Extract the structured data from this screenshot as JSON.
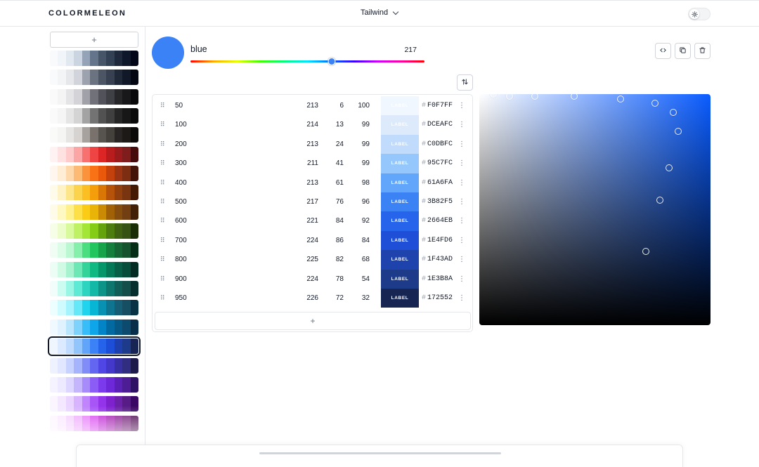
{
  "app": {
    "logo": "COLORMELEON",
    "palette_set": "Tailwind"
  },
  "sidebar": {
    "add_label": "+",
    "palettes": [
      [
        "#f8fafc",
        "#f1f5f9",
        "#e2e8f0",
        "#cbd5e1",
        "#94a3b8",
        "#64748b",
        "#475569",
        "#334155",
        "#1e293b",
        "#0f172a",
        "#020617"
      ],
      [
        "#f9fafb",
        "#f3f4f6",
        "#e5e7eb",
        "#d1d5db",
        "#9ca3af",
        "#6b7280",
        "#4b5563",
        "#374151",
        "#1f2937",
        "#111827",
        "#030712"
      ],
      [
        "#fafafa",
        "#f4f4f5",
        "#e4e4e7",
        "#d4d4d8",
        "#a1a1aa",
        "#71717a",
        "#52525b",
        "#3f3f46",
        "#27272a",
        "#18181b",
        "#09090b"
      ],
      [
        "#fafafa",
        "#f5f5f5",
        "#e5e5e5",
        "#d4d4d4",
        "#a3a3a3",
        "#737373",
        "#525252",
        "#404040",
        "#262626",
        "#171717",
        "#0a0a0a"
      ],
      [
        "#fafaf9",
        "#f5f5f4",
        "#e7e5e4",
        "#d6d3d1",
        "#a8a29e",
        "#78716c",
        "#57534e",
        "#44403c",
        "#292524",
        "#1c1917",
        "#0c0a09"
      ],
      [
        "#fef2f2",
        "#fee2e2",
        "#fecaca",
        "#fca5a5",
        "#f87171",
        "#ef4444",
        "#dc2626",
        "#b91c1c",
        "#991b1b",
        "#7f1d1d",
        "#450a0a"
      ],
      [
        "#fff7ed",
        "#ffedd5",
        "#fed7aa",
        "#fdba74",
        "#fb923c",
        "#f97316",
        "#ea580c",
        "#c2410c",
        "#9a3412",
        "#7c2d12",
        "#431407"
      ],
      [
        "#fffbeb",
        "#fef3c7",
        "#fde68a",
        "#fcd34d",
        "#fbbf24",
        "#f59e0b",
        "#d97706",
        "#b45309",
        "#92400e",
        "#78350f",
        "#451a03"
      ],
      [
        "#fefce8",
        "#fef9c3",
        "#fef08a",
        "#fde047",
        "#facc15",
        "#eab308",
        "#ca8a04",
        "#a16207",
        "#854d0e",
        "#713f12",
        "#422006"
      ],
      [
        "#f7fee7",
        "#ecfccb",
        "#d9f99d",
        "#bef264",
        "#a3e635",
        "#84cc16",
        "#65a30d",
        "#4d7c0f",
        "#3f6212",
        "#365314",
        "#1a2e05"
      ],
      [
        "#f0fdf4",
        "#dcfce7",
        "#bbf7d0",
        "#86efac",
        "#4ade80",
        "#22c55e",
        "#16a34a",
        "#15803d",
        "#166534",
        "#14532d",
        "#052e16"
      ],
      [
        "#ecfdf5",
        "#d1fae5",
        "#a7f3d0",
        "#6ee7b7",
        "#34d399",
        "#10b981",
        "#059669",
        "#047857",
        "#065f46",
        "#064e3b",
        "#022c22"
      ],
      [
        "#f0fdfa",
        "#ccfbf1",
        "#99f6e4",
        "#5eead4",
        "#2dd4bf",
        "#14b8a6",
        "#0d9488",
        "#0f766e",
        "#115e59",
        "#134e4a",
        "#042f2e"
      ],
      [
        "#ecfeff",
        "#cffafe",
        "#a5f3fc",
        "#67e8f9",
        "#22d3ee",
        "#06b6d4",
        "#0891b2",
        "#0e7490",
        "#155e75",
        "#164e63",
        "#083344"
      ],
      [
        "#f0f9ff",
        "#e0f2fe",
        "#bae6fd",
        "#7dd3fc",
        "#38bdf8",
        "#0ea5e9",
        "#0284c7",
        "#0369a1",
        "#075985",
        "#0c4a6e",
        "#082f49"
      ],
      [
        "#eff6ff",
        "#dbeafe",
        "#bfdbfe",
        "#93c5fd",
        "#60a5fa",
        "#3b82f6",
        "#2563eb",
        "#1d4ed8",
        "#1e40af",
        "#1e3a8a",
        "#172554"
      ],
      [
        "#eef2ff",
        "#e0e7ff",
        "#c7d2fe",
        "#a5b4fc",
        "#818cf8",
        "#6366f1",
        "#4f46e5",
        "#4338ca",
        "#3730a3",
        "#312e81",
        "#1e1b4b"
      ],
      [
        "#f5f3ff",
        "#ede9fe",
        "#ddd6fe",
        "#c4b5fd",
        "#a78bfa",
        "#8b5cf6",
        "#7c3aed",
        "#6d28d9",
        "#5b21b6",
        "#4c1d95",
        "#2e1065"
      ],
      [
        "#faf5ff",
        "#f3e8ff",
        "#e9d5ff",
        "#d8b4fe",
        "#c084fc",
        "#a855f7",
        "#9333ea",
        "#7e22ce",
        "#6b21a8",
        "#581c87",
        "#3b0764"
      ],
      [
        "#fdf4ff",
        "#fae8ff",
        "#f5d0fe",
        "#f0abfc",
        "#e879f9",
        "#d946ef",
        "#c026d3",
        "#a21caf",
        "#86198f",
        "#701a75",
        "#4a044e"
      ]
    ],
    "active_index": 15
  },
  "editor": {
    "name": "blue",
    "hue": "217",
    "hue_fraction": 0.603,
    "swatch_color": "#3b82f6",
    "preview_label": "LABEL",
    "add_shade_label": "+",
    "shades": [
      {
        "shade": "50",
        "h": "213",
        "s": "6",
        "l": "100",
        "hex": "F0F7FF",
        "color": "#f0f7ff",
        "text": "#ffffff"
      },
      {
        "shade": "100",
        "h": "214",
        "s": "13",
        "l": "99",
        "hex": "DCEAFC",
        "color": "#dceafc",
        "text": "#ffffff"
      },
      {
        "shade": "200",
        "h": "213",
        "s": "24",
        "l": "99",
        "hex": "C0DBFC",
        "color": "#c0dbfc",
        "text": "#ffffff"
      },
      {
        "shade": "300",
        "h": "211",
        "s": "41",
        "l": "99",
        "hex": "95C7FC",
        "color": "#95c7fc",
        "text": "#ffffff"
      },
      {
        "shade": "400",
        "h": "213",
        "s": "61",
        "l": "98",
        "hex": "61A6FA",
        "color": "#61a6fa",
        "text": "#ffffff"
      },
      {
        "shade": "500",
        "h": "217",
        "s": "76",
        "l": "96",
        "hex": "3B82F5",
        "color": "#3b82f5",
        "text": "#ffffff"
      },
      {
        "shade": "600",
        "h": "221",
        "s": "84",
        "l": "92",
        "hex": "2664EB",
        "color": "#2664eb",
        "text": "#ffffff"
      },
      {
        "shade": "700",
        "h": "224",
        "s": "86",
        "l": "84",
        "hex": "1E4FD6",
        "color": "#1e4fd6",
        "text": "#ffffff"
      },
      {
        "shade": "800",
        "h": "225",
        "s": "82",
        "l": "68",
        "hex": "1F43AD",
        "color": "#1f43ad",
        "text": "#ffffff"
      },
      {
        "shade": "900",
        "h": "224",
        "s": "78",
        "l": "54",
        "hex": "1E3B8A",
        "color": "#1e3b8a",
        "text": "#ffffff"
      },
      {
        "shade": "950",
        "h": "226",
        "s": "72",
        "l": "32",
        "hex": "172552",
        "color": "#172552",
        "text": "#ffffff"
      }
    ]
  },
  "picker": {
    "hue_color": "#0a5cff",
    "points": [
      {
        "s": 0.06,
        "v": 1.0
      },
      {
        "s": 0.13,
        "v": 0.99
      },
      {
        "s": 0.24,
        "v": 0.99
      },
      {
        "s": 0.41,
        "v": 0.99
      },
      {
        "s": 0.61,
        "v": 0.98
      },
      {
        "s": 0.76,
        "v": 0.96
      },
      {
        "s": 0.84,
        "v": 0.92
      },
      {
        "s": 0.86,
        "v": 0.84
      },
      {
        "s": 0.82,
        "v": 0.68
      },
      {
        "s": 0.78,
        "v": 0.54
      },
      {
        "s": 0.72,
        "v": 0.32
      }
    ]
  },
  "icons": {
    "code": "code-icon",
    "copy": "copy-icon",
    "delete": "trash-icon",
    "sort": "sort-icon",
    "theme": "sun-icon",
    "drag": "grip-icon",
    "more": "kebab-icon"
  }
}
